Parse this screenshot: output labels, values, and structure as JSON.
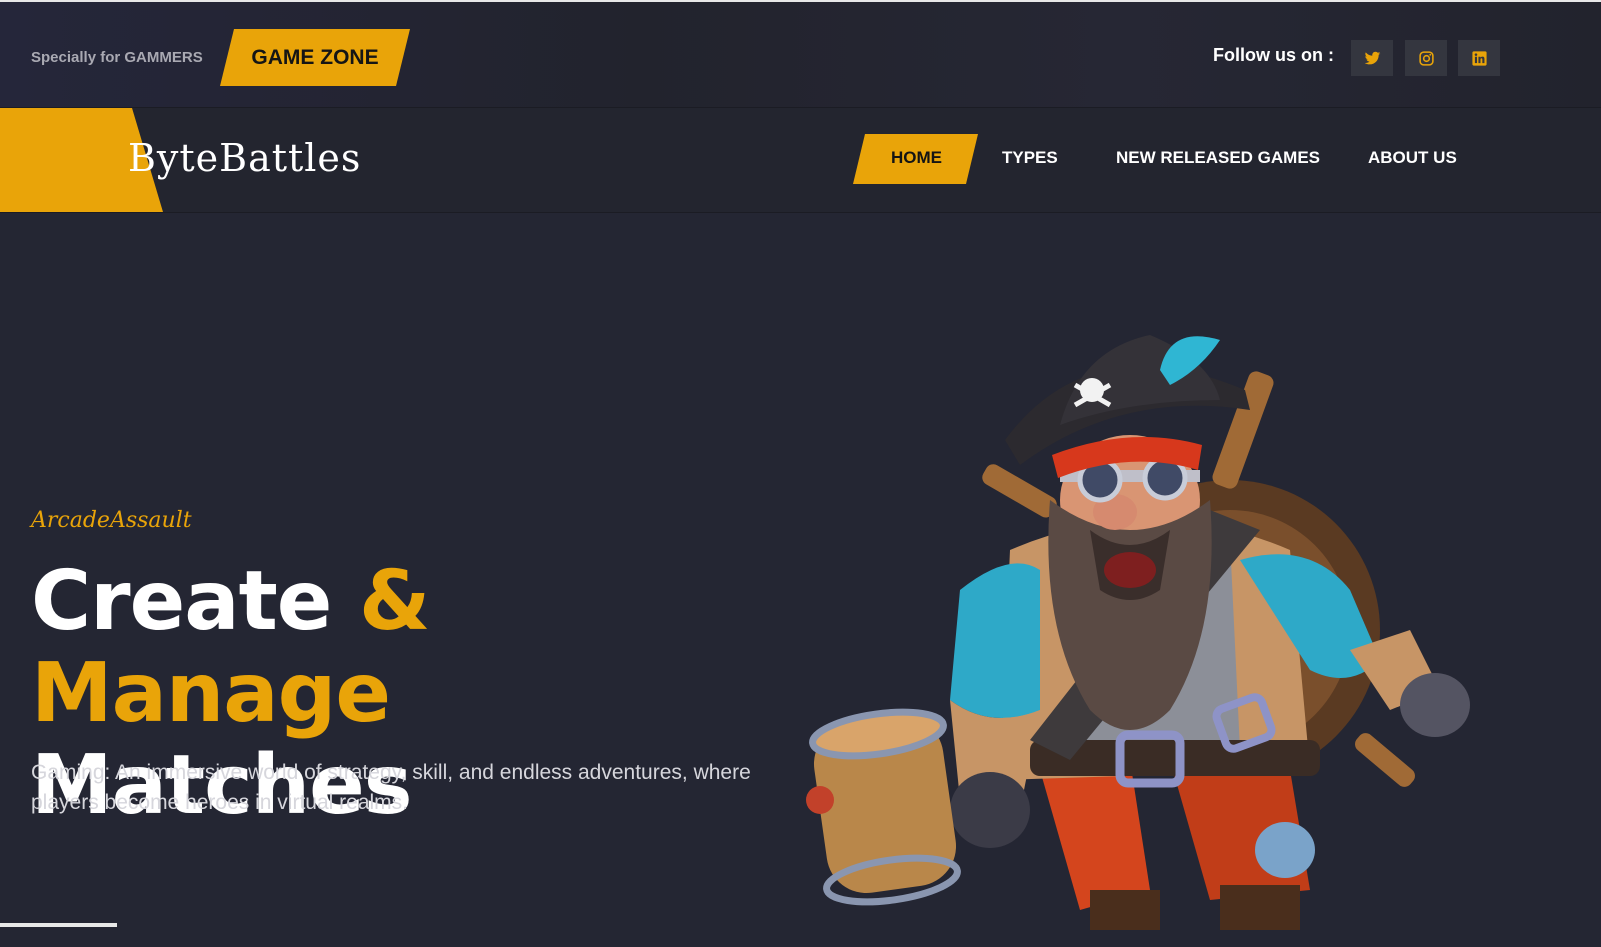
{
  "topbar": {
    "tagline": "Specially for GAMMERS",
    "badge": "GAME ZONE",
    "follow_label": "Follow us on :",
    "social": [
      {
        "icon": "twitter-icon"
      },
      {
        "icon": "instagram-icon"
      },
      {
        "icon": "linkedin-icon"
      }
    ]
  },
  "nav": {
    "logo": "ByteBattles",
    "items": [
      {
        "label": "HOME",
        "active": true
      },
      {
        "label": "TYPES"
      },
      {
        "label": "NEW RELEASED GAMES"
      },
      {
        "label": "ABOUT US"
      }
    ]
  },
  "hero": {
    "subtitle": "ArcadeAssault",
    "title_part1": "Create ",
    "title_accent": "& Manage",
    "title_part2": "Matches",
    "description": "Gaming: An immersive world of strategy, skill, and endless adventures, where players become heroes in virtual realms.",
    "image": "pirate-character"
  },
  "colors": {
    "accent": "#e9a409",
    "background": "#242633",
    "social_bg": "#34363f"
  }
}
